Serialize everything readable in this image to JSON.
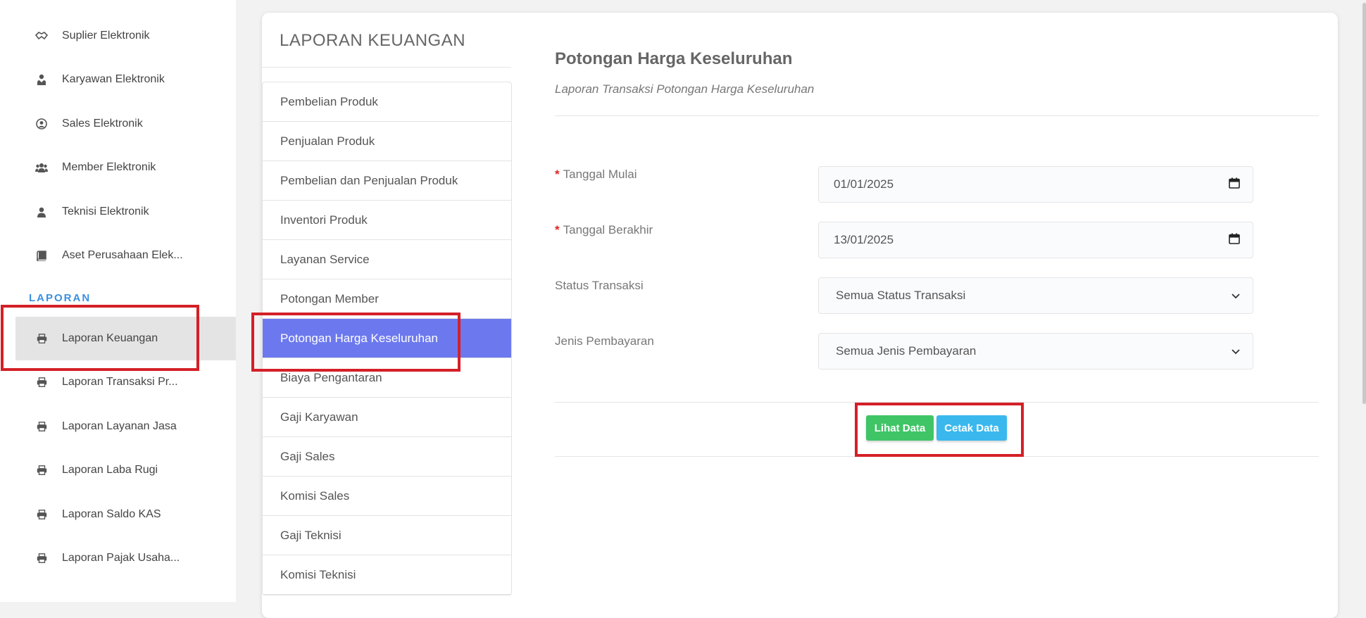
{
  "sidebar": {
    "items_top": [
      {
        "label": "Suplier Elektronik",
        "icon": "handshake-icon"
      },
      {
        "label": "Karyawan Elektronik",
        "icon": "user-tie-icon"
      },
      {
        "label": "Sales Elektronik",
        "icon": "user-circle-icon"
      },
      {
        "label": "Member Elektronik",
        "icon": "users-icon"
      },
      {
        "label": "Teknisi Elektronik",
        "icon": "user-icon"
      },
      {
        "label": "Aset Perusahaan Elek...",
        "icon": "book-icon"
      }
    ],
    "section_label": "LAPORAN",
    "items_laporan": [
      {
        "label": "Laporan Keuangan",
        "icon": "print-icon",
        "active": true
      },
      {
        "label": "Laporan Transaksi Pr...",
        "icon": "print-icon"
      },
      {
        "label": "Laporan Layanan Jasa",
        "icon": "print-icon"
      },
      {
        "label": "Laporan Laba Rugi",
        "icon": "print-icon"
      },
      {
        "label": "Laporan Saldo KAS",
        "icon": "print-icon"
      },
      {
        "label": "Laporan Pajak Usaha...",
        "icon": "print-icon"
      }
    ]
  },
  "card": {
    "title": "LAPORAN KEUANGAN",
    "menu": [
      "Pembelian Produk",
      "Penjualan Produk",
      "Pembelian dan Penjualan Produk",
      "Inventori Produk",
      "Layanan Service",
      "Potongan Member",
      "Potongan Harga Keseluruhan",
      "Biaya Pengantaran",
      "Gaji Karyawan",
      "Gaji Sales",
      "Komisi Sales",
      "Gaji Teknisi",
      "Komisi Teknisi"
    ],
    "active_menu": "Potongan Harga Keseluruhan"
  },
  "content": {
    "title": "Potongan Harga Keseluruhan",
    "subtitle": "Laporan Transaksi Potongan Harga Keseluruhan",
    "form": {
      "required_mark": "*",
      "tanggal_mulai_label": "Tanggal Mulai",
      "tanggal_mulai_value": "01/01/2025",
      "tanggal_berakhir_label": "Tanggal Berakhir",
      "tanggal_berakhir_value": "13/01/2025",
      "status_label": "Status Transaksi",
      "status_value": "Semua Status Transaksi",
      "jenis_label": "Jenis Pembayaran",
      "jenis_value": "Semua Jenis Pembayaran"
    },
    "buttons": {
      "lihat": "Lihat Data",
      "cetak": "Cetak Data"
    }
  },
  "colors": {
    "accent": "#6c79ee",
    "section": "#3b8fe0",
    "btn_green": "#3fc566",
    "btn_blue": "#3ab8ee",
    "highlight": "#d42027"
  }
}
